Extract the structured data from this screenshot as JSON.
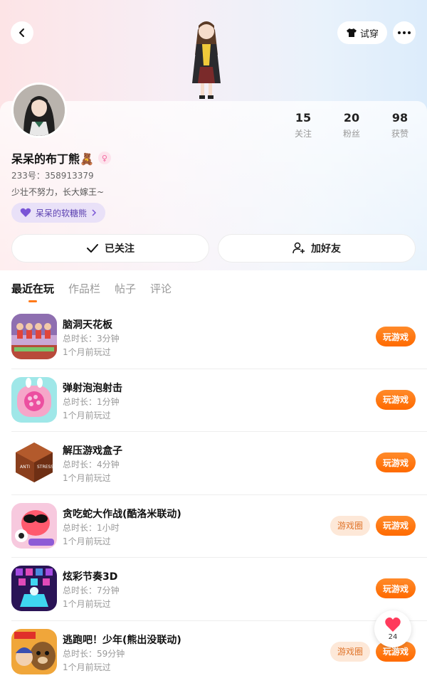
{
  "header": {
    "tryon_label": "试穿"
  },
  "profile": {
    "stats": [
      {
        "value": "15",
        "label": "关注"
      },
      {
        "value": "20",
        "label": "粉丝"
      },
      {
        "value": "98",
        "label": "获赞"
      }
    ],
    "name": "呆呆的布丁熊🧸",
    "gender_symbol": "♀",
    "uid": "233号：358913379",
    "bio": "少壮不努力，长大嫁王~",
    "fan_tag": "呆呆的软糖熊"
  },
  "actions": {
    "followed_label": "已关注",
    "add_friend_label": "加好友"
  },
  "tabs": [
    "最近在玩",
    "作品栏",
    "帖子",
    "评论"
  ],
  "games": [
    {
      "title": "脑洞天花板",
      "duration": "总时长：3分钟",
      "last_played": "1个月前玩过",
      "has_circle": false,
      "icon": "game-icon-naodong"
    },
    {
      "title": "弹射泡泡射击",
      "duration": "总时长：1分钟",
      "last_played": "1个月前玩过",
      "has_circle": false,
      "icon": "game-icon-bubble"
    },
    {
      "title": "解压游戏盒子",
      "duration": "总时长：4分钟",
      "last_played": "1个月前玩过",
      "has_circle": false,
      "icon": "game-icon-antistress"
    },
    {
      "title": "贪吃蛇大作战(酷洛米联动)",
      "duration": "总时长：1小时",
      "last_played": "1个月前玩过",
      "has_circle": true,
      "icon": "game-icon-snake"
    },
    {
      "title": "炫彩节奏3D",
      "duration": "总时长：7分钟",
      "last_played": "1个月前玩过",
      "has_circle": false,
      "icon": "game-icon-rhythm"
    },
    {
      "title": "逃跑吧！少年(熊出没联动)",
      "duration": "总时长：59分钟",
      "last_played": "1个月前玩过",
      "has_circle": true,
      "icon": "game-icon-escape"
    }
  ],
  "buttons": {
    "play_label": "玩游戏",
    "circle_label": "游戏圈"
  },
  "like": {
    "count": "24"
  },
  "colors": {
    "accent": "#ff6a00",
    "tag_bg": "#e9e1f8"
  }
}
